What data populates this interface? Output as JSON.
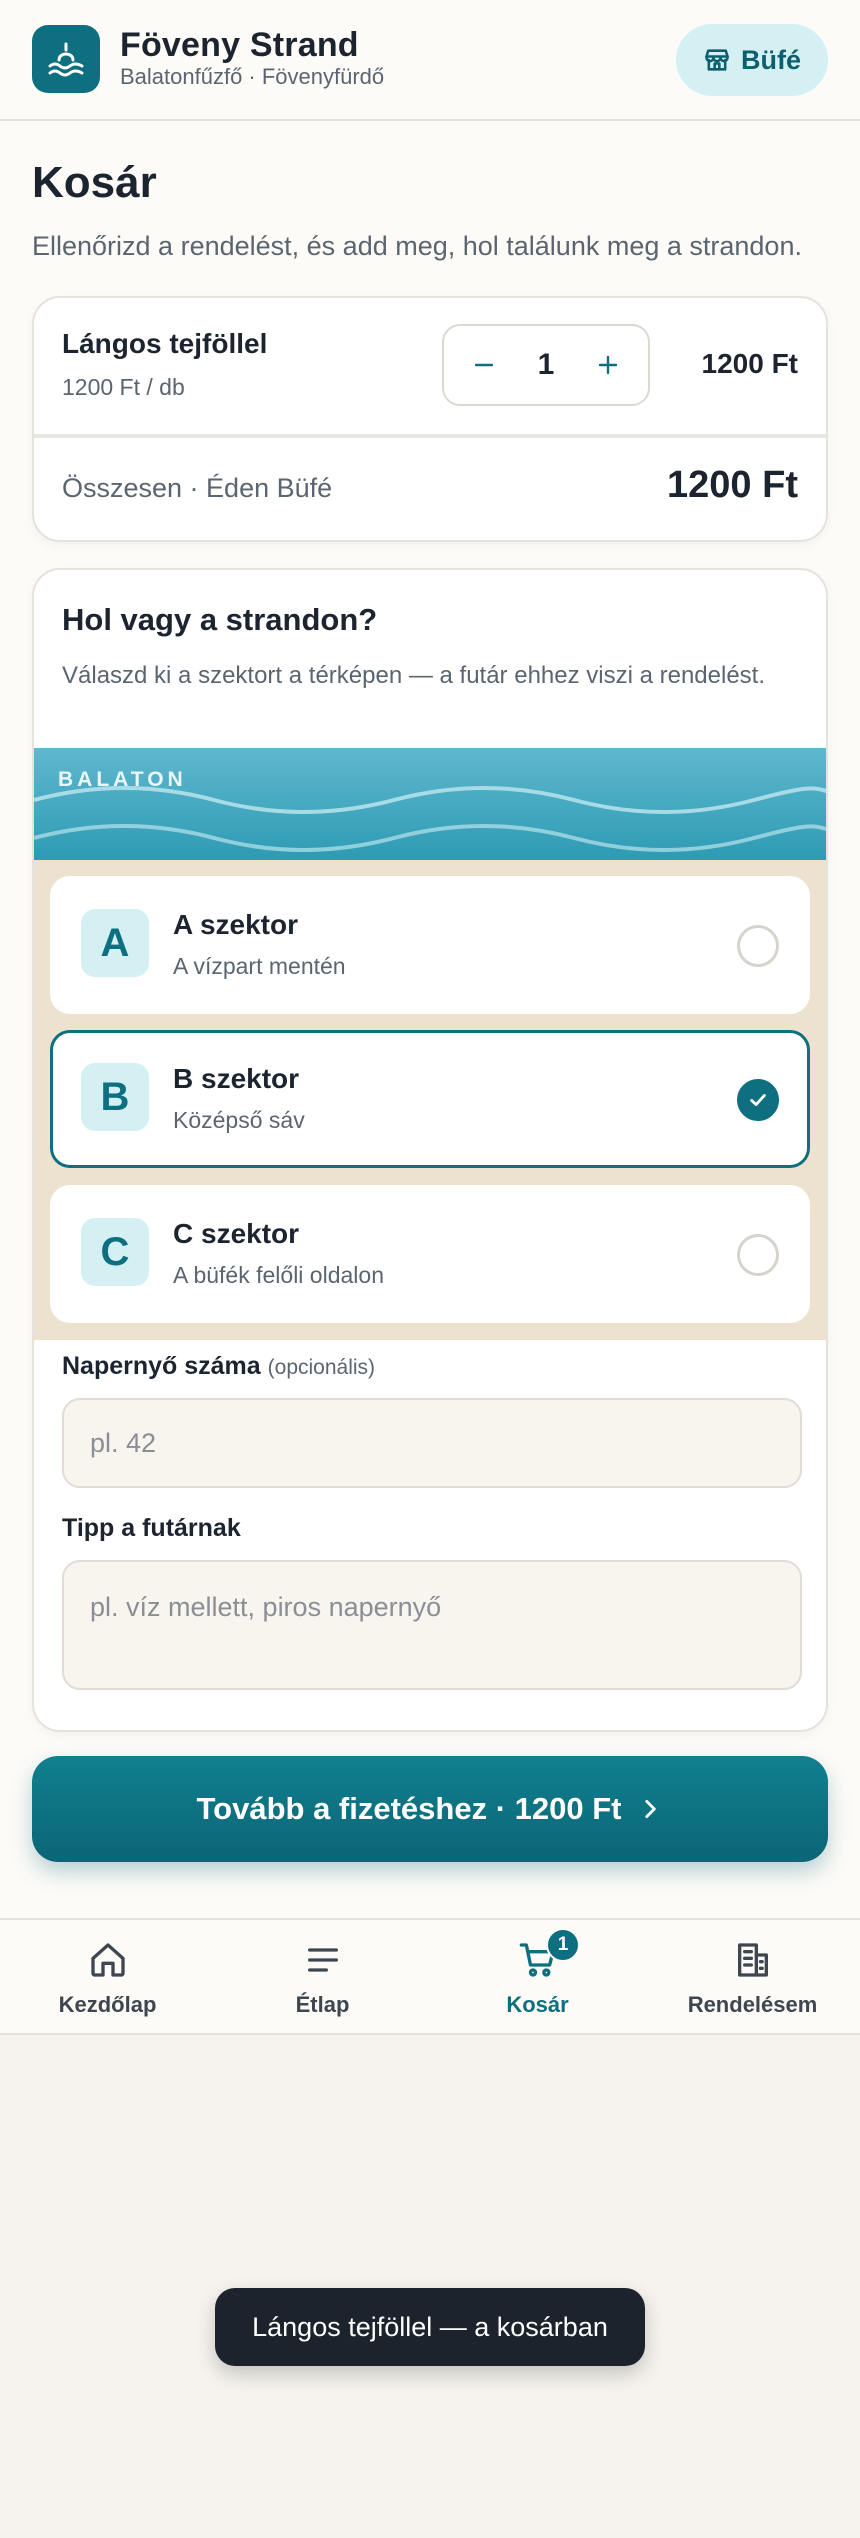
{
  "header": {
    "brand_title": "Föveny Strand",
    "brand_subtitle": "Balatonfűzfő · Fövenyfürdő",
    "bufe_label": "Büfé"
  },
  "page": {
    "title": "Kosár",
    "subtitle": "Ellenőrizd a rendelést, és add meg, hol találunk meg a strandon."
  },
  "cart": {
    "item_name": "Lángos tejföllel",
    "item_unit_price": "1200 Ft / db",
    "quantity": "1",
    "item_price": "1200 Ft",
    "total_label": "Összesen · Éden Büfé",
    "total_value": "1200 Ft"
  },
  "location": {
    "title": "Hol vagy a strandon?",
    "description": "Válaszd ki a szektort a térképen — a futár ehhez viszi a rendelést.",
    "water_label": "BALATON",
    "sectors": [
      {
        "letter": "A",
        "name": "A szektor",
        "desc": "A vízpart mentén",
        "selected": false
      },
      {
        "letter": "B",
        "name": "B szektor",
        "desc": "Középső sáv",
        "selected": true
      },
      {
        "letter": "C",
        "name": "C szektor",
        "desc": "A büfék felőli oldalon",
        "selected": false
      }
    ],
    "umbrella_label": "Napernyő száma",
    "umbrella_optional": "(opcionális)",
    "umbrella_placeholder": "pl. 42",
    "tip_label": "Tipp a futárnak",
    "tip_placeholder": "pl. víz mellett, piros napernyő"
  },
  "cta": {
    "label": "Tovább a fizetéshez · 1200 Ft"
  },
  "nav": {
    "items": [
      {
        "label": "Kezdőlap",
        "icon": "home-icon"
      },
      {
        "label": "Étlap",
        "icon": "menu-icon"
      },
      {
        "label": "Kosár",
        "icon": "cart-icon",
        "badge": "1"
      },
      {
        "label": "Rendelésem",
        "icon": "receipt-icon"
      }
    ]
  },
  "toast": {
    "message": "Lángos tejföllel — a kosárban"
  },
  "colors": {
    "accent": "#0d6f80",
    "accent_light": "#d4f0f3",
    "sand": "#ece2cf",
    "water": "#2d9bb3",
    "toast_bg": "#1c232d"
  }
}
